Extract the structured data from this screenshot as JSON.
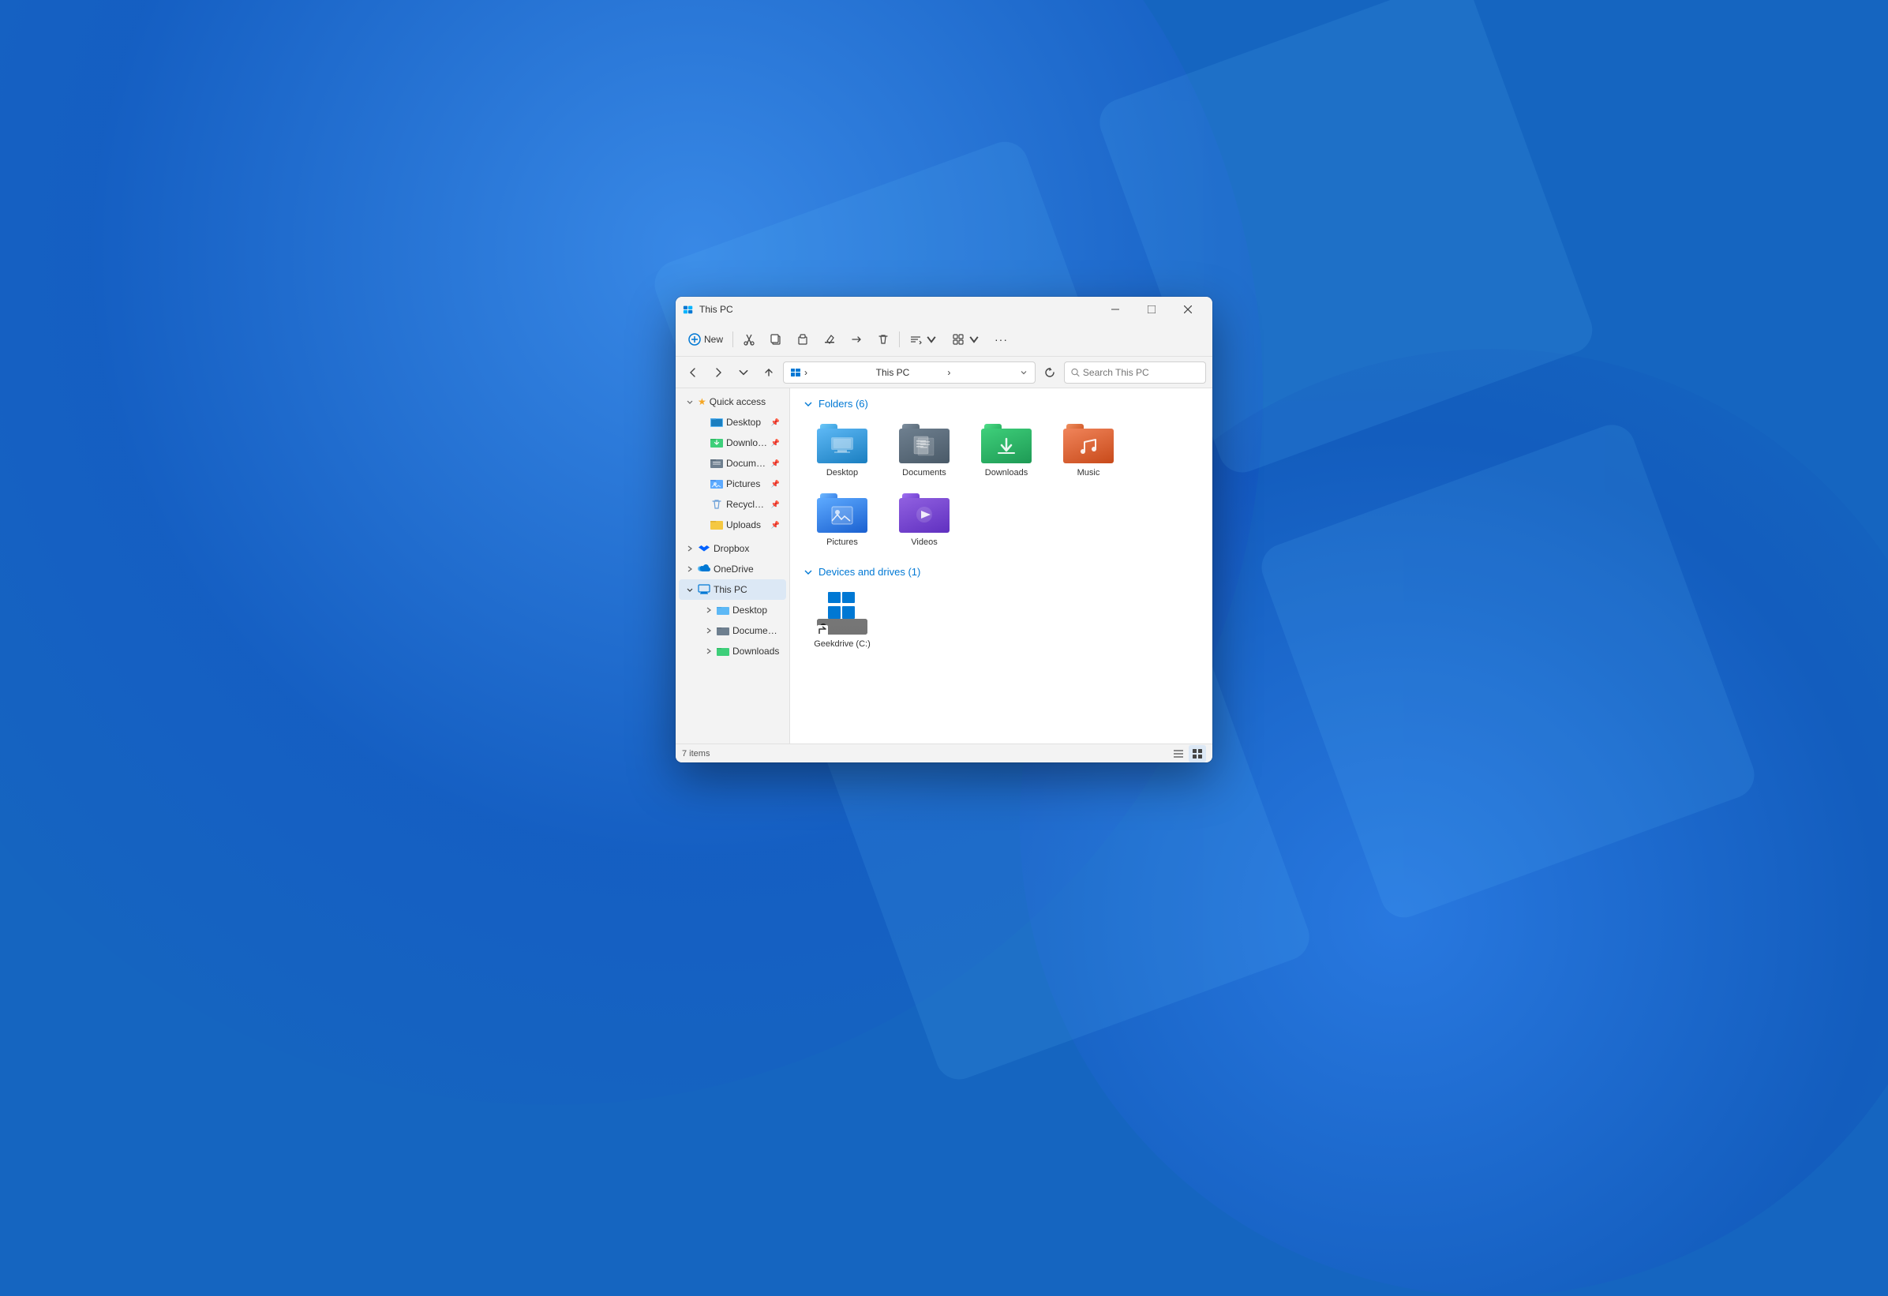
{
  "background": {
    "color": "#1a6bc4"
  },
  "window": {
    "title": "This PC",
    "status": "7 items"
  },
  "titlebar": {
    "minimize_label": "—",
    "restore_label": "□",
    "close_label": "✕"
  },
  "toolbar": {
    "new_label": "New",
    "more_label": "···"
  },
  "address": {
    "path": "This PC",
    "search_placeholder": "Search This PC"
  },
  "sidebar": {
    "quick_access_label": "Quick access",
    "quick_access_items": [
      {
        "label": "Desktop",
        "pinned": true
      },
      {
        "label": "Downloads",
        "pinned": true
      },
      {
        "label": "Documents",
        "pinned": true
      },
      {
        "label": "Pictures",
        "pinned": true
      },
      {
        "label": "Recycle Bin",
        "pinned": true
      },
      {
        "label": "Uploads",
        "pinned": true
      }
    ],
    "dropbox_label": "Dropbox",
    "onedrive_label": "OneDrive",
    "this_pc_label": "This PC",
    "this_pc_items": [
      {
        "label": "Desktop"
      },
      {
        "label": "Documents"
      },
      {
        "label": "Downloads"
      }
    ]
  },
  "main": {
    "folders_section": "Folders (6)",
    "devices_section": "Devices and drives (1)",
    "folders": [
      {
        "label": "Desktop",
        "type": "desktop"
      },
      {
        "label": "Documents",
        "type": "documents"
      },
      {
        "label": "Downloads",
        "type": "downloads"
      },
      {
        "label": "Music",
        "type": "music"
      },
      {
        "label": "Pictures",
        "type": "pictures"
      },
      {
        "label": "Videos",
        "type": "videos"
      }
    ],
    "drives": [
      {
        "label": "Geekdrive (C:)",
        "type": "hdd"
      }
    ]
  },
  "statusbar": {
    "item_count": "7 items"
  },
  "icons": {
    "cut": "✂",
    "copy": "⧉",
    "paste": "📋",
    "rename": "✏",
    "delete": "🗑",
    "sort": "↕",
    "view": "⊡",
    "more": "···",
    "back": "←",
    "forward": "→",
    "up": "↑",
    "search": "🔍",
    "refresh": "↻",
    "chevron_down": "›",
    "expand": "›",
    "collapse": "⌄",
    "pin": "📌",
    "list_view": "≡",
    "grid_view": "⊞"
  }
}
